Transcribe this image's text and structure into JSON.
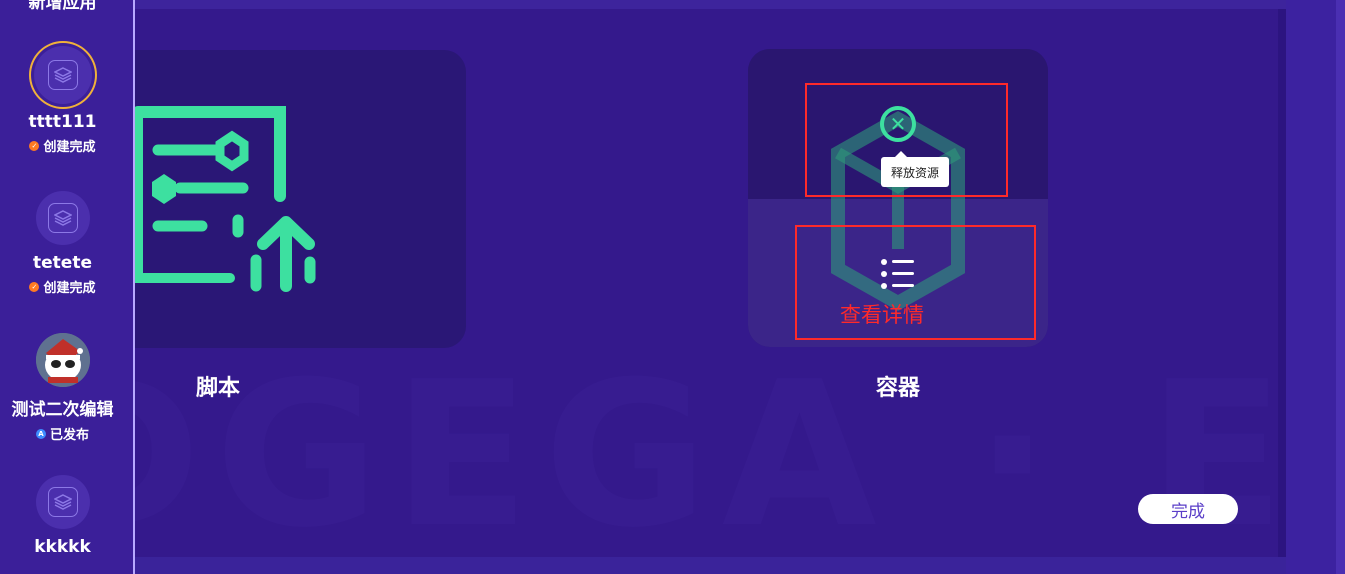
{
  "sidebar": {
    "top_partial_label": "新增应用",
    "apps": [
      {
        "name": "tttt111",
        "status": "创建完成",
        "status_color": "#ff7a22",
        "avatar": "stack-icon",
        "selected": true
      },
      {
        "name": "tetete",
        "status": "创建完成",
        "status_color": "#ff7a22",
        "avatar": "stack-icon",
        "selected": false
      },
      {
        "name": "测试二次编辑",
        "status": "已发布",
        "status_color": "#3d8cff",
        "avatar": "panda-avatar",
        "selected": false
      },
      {
        "name": "kkkkk",
        "status": "",
        "avatar": "stack-icon",
        "selected": false
      }
    ]
  },
  "cards": {
    "script": {
      "label": "脚本",
      "icon": "script-upload-icon"
    },
    "container": {
      "label": "容器",
      "icon": "container-cube-icon"
    }
  },
  "container_actions": {
    "release": {
      "icon": "close-circle-icon",
      "tooltip": "释放资源"
    },
    "details": {
      "icon": "list-icon",
      "annotation": "查看详情"
    }
  },
  "footer": {
    "done_label": "完成"
  },
  "colors": {
    "accent_green": "#3de0a0",
    "annotation_red": "#ff2a2a",
    "selected_ring": "#f0b13a"
  }
}
